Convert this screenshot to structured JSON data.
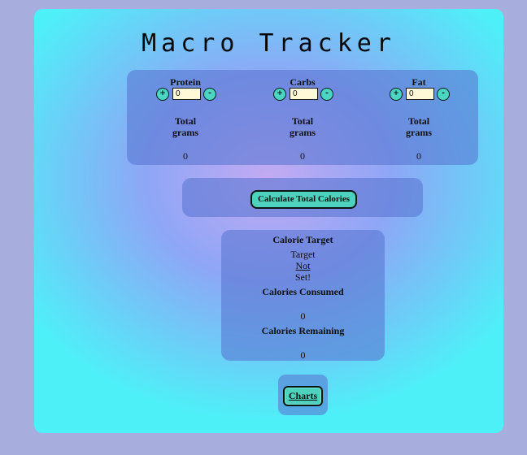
{
  "app": {
    "title": "Macro Tracker"
  },
  "macros": {
    "items": [
      {
        "name": "Protein",
        "plus_label": "+",
        "minus_label": "-",
        "value": "0",
        "total_label_line1": "Total",
        "total_label_line2": "grams",
        "total_value": "0"
      },
      {
        "name": "Carbs",
        "plus_label": "+",
        "minus_label": "-",
        "value": "0",
        "total_label_line1": "Total",
        "total_label_line2": "grams",
        "total_value": "0"
      },
      {
        "name": "Fat",
        "plus_label": "+",
        "minus_label": "-",
        "value": "0",
        "total_label_line1": "Total",
        "total_label_line2": "grams",
        "total_value": "0"
      }
    ]
  },
  "calculate": {
    "button_label": "Calculate Total Calories"
  },
  "calories": {
    "target_heading": "Calorie Target",
    "target_line1": "Target",
    "target_line2": "Not",
    "target_line3": "Set!",
    "consumed_heading": "Calories Consumed",
    "consumed_value": "0",
    "remaining_heading": "Calories Remaining",
    "remaining_value": "0"
  },
  "charts": {
    "button_label": "Charts"
  },
  "colors": {
    "card_outer": "#4ef0f8",
    "card_center": "#c3aaf2",
    "button_bg": "#4fd2bd",
    "input_bg": "#fff9d8",
    "page_bg": "#a7addc"
  }
}
